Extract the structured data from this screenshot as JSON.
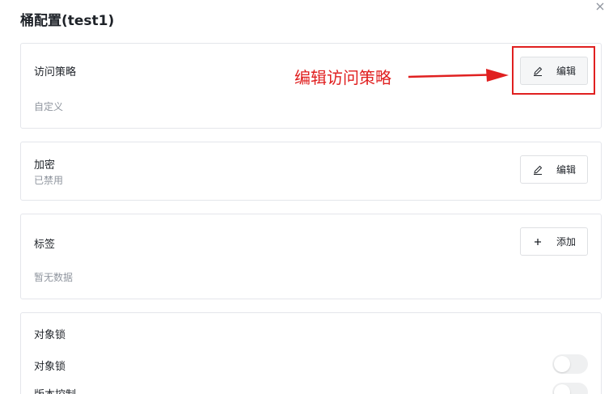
{
  "dialog": {
    "title": "桶配置(test1)",
    "close_icon": "close-icon"
  },
  "access_policy": {
    "label": "访问策略",
    "value": "自定义",
    "button_label": "编辑",
    "button_icon": "edit-icon"
  },
  "encryption": {
    "label": "加密",
    "value": "已禁用",
    "button_label": "编辑",
    "button_icon": "edit-icon"
  },
  "tags": {
    "label": "标签",
    "empty_text": "暂无数据",
    "button_label": "添加",
    "button_icon": "plus-icon"
  },
  "object_lock": {
    "section_label": "对象锁",
    "row_label": "对象锁",
    "row_enabled": false,
    "versioning_label": "版本控制",
    "versioning_enabled": false
  },
  "annotation": {
    "text": "编辑访问策略",
    "color": "#e02020"
  },
  "colors": {
    "border": "#e4e6eb",
    "muted_text": "#8f959e",
    "switch_off": "#eff0f1"
  }
}
